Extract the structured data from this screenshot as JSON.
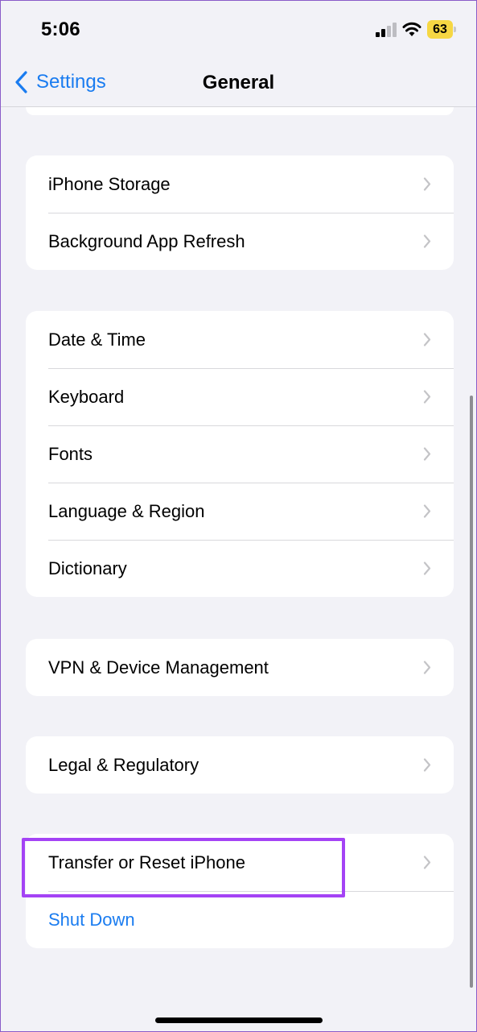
{
  "status_bar": {
    "time": "5:06",
    "battery_level": "63",
    "battery_color": "#f6d743"
  },
  "nav": {
    "back_label": "Settings",
    "title": "General"
  },
  "groups": [
    {
      "rows": [
        {
          "label": "iPhone Storage"
        },
        {
          "label": "Background App Refresh"
        }
      ]
    },
    {
      "rows": [
        {
          "label": "Date & Time"
        },
        {
          "label": "Keyboard"
        },
        {
          "label": "Fonts"
        },
        {
          "label": "Language & Region"
        },
        {
          "label": "Dictionary"
        }
      ]
    },
    {
      "rows": [
        {
          "label": "VPN & Device Management"
        }
      ]
    },
    {
      "rows": [
        {
          "label": "Legal & Regulatory"
        }
      ]
    },
    {
      "rows": [
        {
          "label": "Transfer or Reset iPhone"
        },
        {
          "label": "Shut Down"
        }
      ]
    }
  ],
  "colors": {
    "accent": "#1a7cf0",
    "highlight": "#a443f5",
    "background": "#f2f2f7"
  },
  "icons": {
    "back": "chevron-left-icon",
    "row": "chevron-right-icon"
  }
}
